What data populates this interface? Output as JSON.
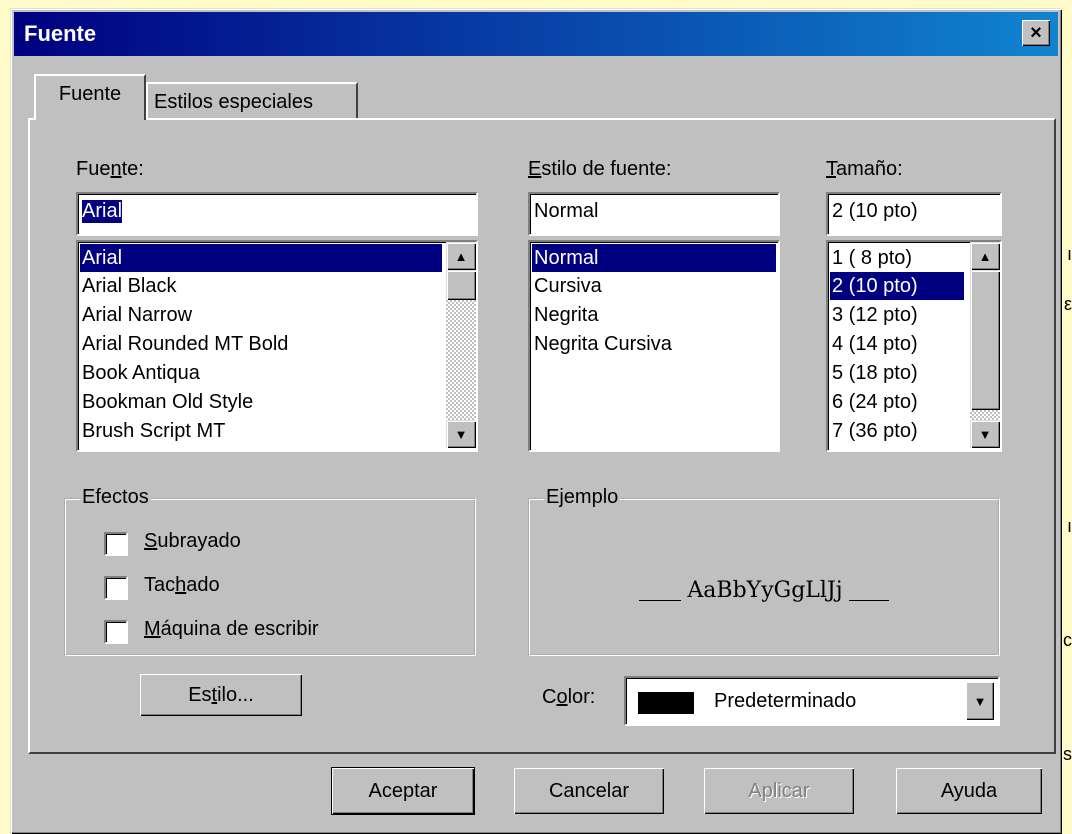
{
  "window": {
    "title": "Fuente",
    "close_label": "×"
  },
  "tabs": [
    {
      "label": "Fuente",
      "active": true
    },
    {
      "label": "Estilos especiales",
      "active": false
    }
  ],
  "font": {
    "label": "Fuente:",
    "value": "Arial",
    "items": [
      "Arial",
      "Arial Black",
      "Arial Narrow",
      "Arial Rounded MT Bold",
      "Book Antiqua",
      "Bookman Old Style",
      "Brush Script MT"
    ],
    "selected": "Arial"
  },
  "style": {
    "label": "Estilo de fuente:",
    "value": "Normal",
    "items": [
      "Normal",
      "Cursiva",
      "Negrita",
      "Negrita Cursiva"
    ],
    "selected": "Normal"
  },
  "size": {
    "label": "Tamaño:",
    "value": "2 (10 pto)",
    "items": [
      "1 ( 8 pto)",
      "2 (10 pto)",
      "3 (12 pto)",
      "4 (14 pto)",
      "5 (18 pto)",
      "6 (24 pto)",
      "7 (36 pto)"
    ],
    "selected": "2 (10 pto)"
  },
  "effects": {
    "title": "Efectos",
    "items": [
      {
        "label": "Subrayado",
        "checked": false
      },
      {
        "label": "Tachado",
        "checked": false
      },
      {
        "label": "Máquina de escribir",
        "checked": false
      }
    ]
  },
  "sample": {
    "title": "Ejemplo",
    "text": "AaBbYyGgLlJj"
  },
  "style_button": "Estilo...",
  "color": {
    "label": "Color:",
    "value": "Predeterminado",
    "swatch": "#000000"
  },
  "buttons": {
    "ok": "Aceptar",
    "cancel": "Cancelar",
    "apply": "Aplicar",
    "help": "Ayuda"
  },
  "colors": {
    "title_bar": "#000080",
    "selection": "#000080",
    "face": "#c0c0c0",
    "desktop": "#fffbc8"
  }
}
